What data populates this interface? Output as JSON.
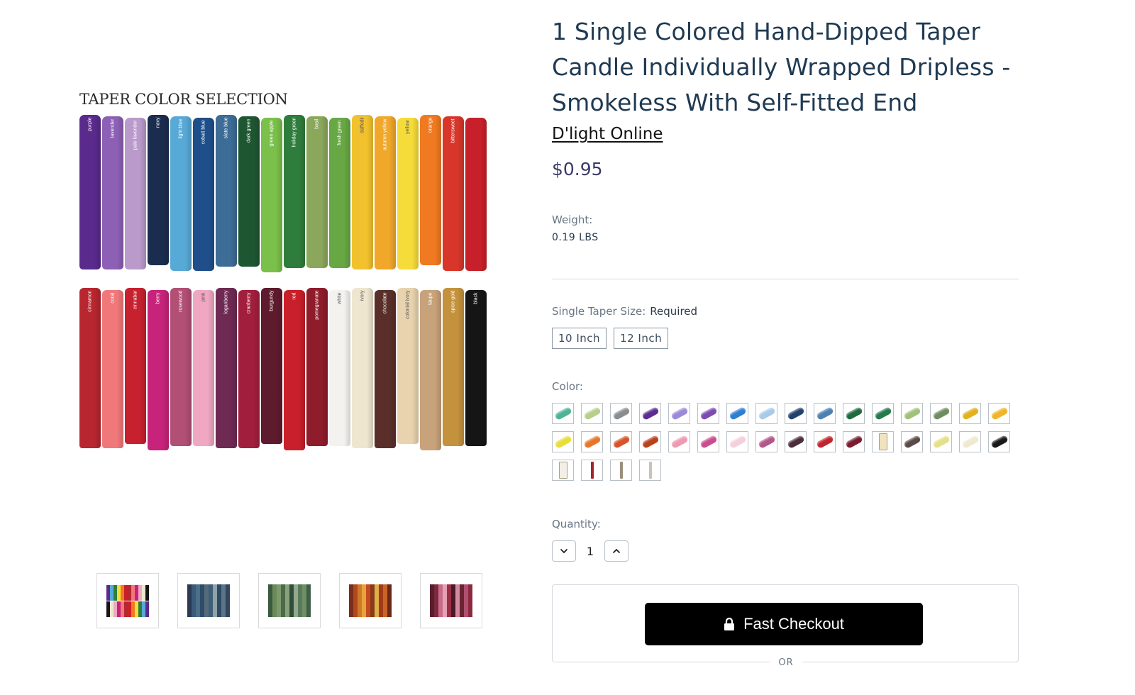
{
  "product": {
    "title": "1 Single Colored Hand-Dipped Taper Candle Individually Wrapped Dripless - Smokeless With Self-Fitted End",
    "brand": "D'light Online",
    "price": "$0.95",
    "weight_label": "Weight:",
    "weight_value": "0.19 LBS"
  },
  "image": {
    "title": "TAPER COLOR SELECTION",
    "top_row": [
      {
        "name": "purple",
        "color": "#5a2a8c"
      },
      {
        "name": "lavender",
        "color": "#8d5fb5"
      },
      {
        "name": "pale lavender",
        "color": "#b99acb"
      },
      {
        "name": "navy",
        "color": "#1b2d4f"
      },
      {
        "name": "light blue",
        "color": "#57a9d6"
      },
      {
        "name": "cobalt blue",
        "color": "#1f4f8a"
      },
      {
        "name": "slate blue",
        "color": "#3d6c97"
      },
      {
        "name": "dark green",
        "color": "#1f5632"
      },
      {
        "name": "green apple",
        "color": "#7ac04a"
      },
      {
        "name": "holiday green",
        "color": "#2f7d3c"
      },
      {
        "name": "basil",
        "color": "#8aa75b"
      },
      {
        "name": "fresh green",
        "color": "#68a844"
      },
      {
        "name": "daffodil",
        "color": "#f2c22e"
      },
      {
        "name": "autumn yellow",
        "color": "#f0a72a"
      },
      {
        "name": "yellow",
        "color": "#f5dc3a"
      },
      {
        "name": "orange",
        "color": "#f07a22"
      },
      {
        "name": "bittersweet",
        "color": "#d8362a"
      },
      {
        "name": "",
        "color": "#c8202a"
      }
    ],
    "bottom_row": [
      {
        "name": "cinnamon",
        "color": "#b8262f"
      },
      {
        "name": "coral",
        "color": "#f1787a"
      },
      {
        "name": "cinnabar",
        "color": "#c7202f"
      },
      {
        "name": "berry",
        "color": "#c8237a"
      },
      {
        "name": "rosewood",
        "color": "#b24f74"
      },
      {
        "name": "pink",
        "color": "#f0a7c1"
      },
      {
        "name": "loganberry",
        "color": "#6e2a52"
      },
      {
        "name": "cranberry",
        "color": "#a21e3d"
      },
      {
        "name": "burgundy",
        "color": "#5e1b2e"
      },
      {
        "name": "red",
        "color": "#c91f2a"
      },
      {
        "name": "pomegranate",
        "color": "#8f1c2b"
      },
      {
        "name": "white",
        "color": "#f4f2ee"
      },
      {
        "name": "ivory",
        "color": "#efe6cf"
      },
      {
        "name": "chocolate",
        "color": "#5a2f2a"
      },
      {
        "name": "colonial ivory",
        "color": "#e8d3ae"
      },
      {
        "name": "taupe",
        "color": "#c8a27a"
      },
      {
        "name": "spice gold",
        "color": "#c4923c"
      },
      {
        "name": "black",
        "color": "#151515"
      }
    ]
  },
  "thumbnails": [
    {
      "colors": [
        "#5a2a8c",
        "#57a9d6",
        "#2f7d3c",
        "#f5dc3a",
        "#f07a22",
        "#c8202a",
        "#b8262f",
        "#f1787a",
        "#c8237a",
        "#f0a7c1",
        "#efe6cf",
        "#151515"
      ],
      "two_rows": true
    },
    {
      "colors": [
        "#2a3a55",
        "#3b5a7a",
        "#4c6e86",
        "#2e4d6a",
        "#556b7a",
        "#3f5f78",
        "#8fa3a9",
        "#2f4a63",
        "#5b7487",
        "#33465e"
      ],
      "two_rows": false
    },
    {
      "colors": [
        "#3c5a3e",
        "#6b8a5a",
        "#7d9a6e",
        "#4a6a4a",
        "#8aa07a",
        "#2f4f3a",
        "#94a88e",
        "#587a5a",
        "#6e8f66",
        "#3f5e46"
      ],
      "two_rows": false
    },
    {
      "colors": [
        "#7a2e1c",
        "#b0481e",
        "#d0782a",
        "#e6a53a",
        "#c44a22",
        "#8a3a1c",
        "#e0b048",
        "#a23a1a",
        "#c86428",
        "#6a2818"
      ],
      "two_rows": false
    },
    {
      "colors": [
        "#5a1e2a",
        "#7a2a3c",
        "#c86a88",
        "#e6a0b4",
        "#9a3048",
        "#4a1a26",
        "#d48aa0",
        "#6a2434",
        "#b05070",
        "#8a2a40"
      ],
      "two_rows": false
    }
  ],
  "size": {
    "label": "Single Taper Size:",
    "required": "Required",
    "options": [
      "10 Inch",
      "12 Inch"
    ]
  },
  "color": {
    "label": "Color:",
    "swatches": [
      {
        "type": "pill",
        "color": "#4fb39a"
      },
      {
        "type": "pill",
        "color": "#b7cf8a"
      },
      {
        "type": "pill",
        "color": "#8a8d90"
      },
      {
        "type": "pill",
        "color": "#5b2c92"
      },
      {
        "type": "pill",
        "color": "#9c8ad6"
      },
      {
        "type": "pill",
        "color": "#7e4bb3"
      },
      {
        "type": "pill",
        "color": "#2f7fd0"
      },
      {
        "type": "pill",
        "color": "#a8cbe8"
      },
      {
        "type": "pill",
        "color": "#23426b"
      },
      {
        "type": "pill",
        "color": "#4d80b3"
      },
      {
        "type": "pill",
        "color": "#1f6a3e"
      },
      {
        "type": "pill",
        "color": "#237a4a"
      },
      {
        "type": "pill",
        "color": "#9fc27a"
      },
      {
        "type": "pill",
        "color": "#6f8d5f"
      },
      {
        "type": "pill",
        "color": "#e3b11e"
      },
      {
        "type": "pill",
        "color": "#f0b52a"
      },
      {
        "type": "pill",
        "color": "#e8de3a"
      },
      {
        "type": "pill",
        "color": "#e9752a"
      },
      {
        "type": "pill",
        "color": "#d8542a"
      },
      {
        "type": "pill",
        "color": "#b8421c"
      },
      {
        "type": "pill",
        "color": "#ee9ab2"
      },
      {
        "type": "pill",
        "color": "#c94e8e"
      },
      {
        "type": "pill",
        "color": "#f4cfdc"
      },
      {
        "type": "pill",
        "color": "#b3578a"
      },
      {
        "type": "pill",
        "color": "#4a2d38"
      },
      {
        "type": "pill",
        "color": "#c0262f"
      },
      {
        "type": "pill",
        "color": "#7a1c2e"
      },
      {
        "type": "stick-wide",
        "color": "#efe3c0"
      },
      {
        "type": "pill",
        "color": "#5a4a48"
      },
      {
        "type": "pill",
        "color": "#e6df8a"
      },
      {
        "type": "pill",
        "color": "#efe9cf"
      },
      {
        "type": "pill",
        "color": "#1a1a1a"
      },
      {
        "type": "stick-wide",
        "color": "#f2efe6"
      },
      {
        "type": "stick",
        "color": "#a5232f"
      },
      {
        "type": "stick",
        "color": "#9a8f7a"
      },
      {
        "type": "stick",
        "color": "#c7c2ba"
      }
    ]
  },
  "quantity": {
    "label": "Quantity:",
    "value": "1"
  },
  "checkout": {
    "fast_checkout": "Fast Checkout",
    "or": "OR"
  }
}
